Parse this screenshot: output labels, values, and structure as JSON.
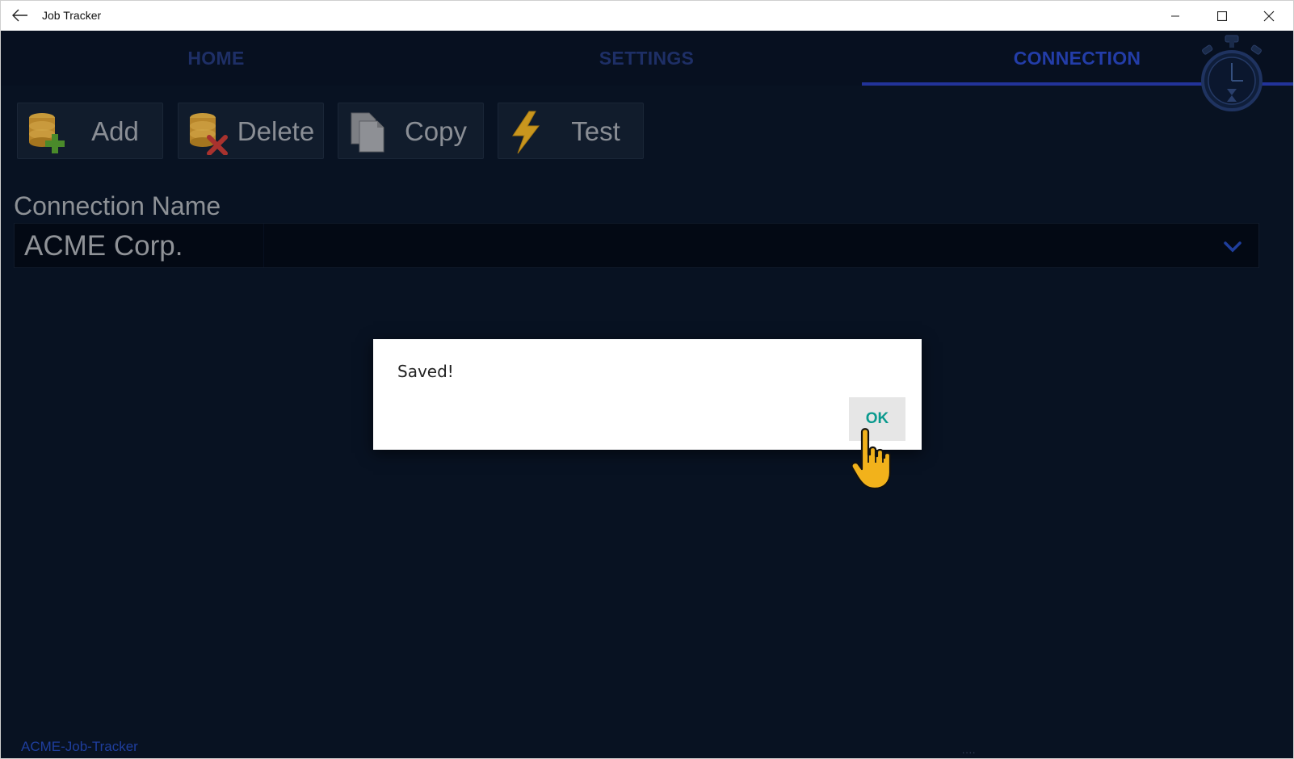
{
  "window": {
    "title": "Job Tracker",
    "back_icon": "arrow-left-icon",
    "controls": [
      "minimize-icon",
      "maximize-icon",
      "close-icon"
    ]
  },
  "tabs": [
    {
      "label": "HOME",
      "active": false
    },
    {
      "label": "SETTINGS",
      "active": false
    },
    {
      "label": "CONNECTION",
      "active": true
    }
  ],
  "logo_icon": "stopwatch-icon",
  "toolbar": {
    "buttons": [
      {
        "label": "Add",
        "icon": "database-add-icon"
      },
      {
        "label": "Delete",
        "icon": "database-delete-icon"
      },
      {
        "label": "Copy",
        "icon": "copy-documents-icon"
      },
      {
        "label": "Test",
        "icon": "lightning-icon"
      }
    ]
  },
  "connection": {
    "label": "Connection Name",
    "selected": "ACME Corp."
  },
  "footer": {
    "app_name": "ACME-Job-Tracker",
    "dots": "...."
  },
  "dialog": {
    "message": "Saved!",
    "ok_label": "OK"
  },
  "colors": {
    "background": "#081222",
    "active_tab": "#233da8",
    "inactive_tab": "#1e2f66",
    "ok_text": "#0b9a8e",
    "footer_text": "#1f3e9d"
  }
}
